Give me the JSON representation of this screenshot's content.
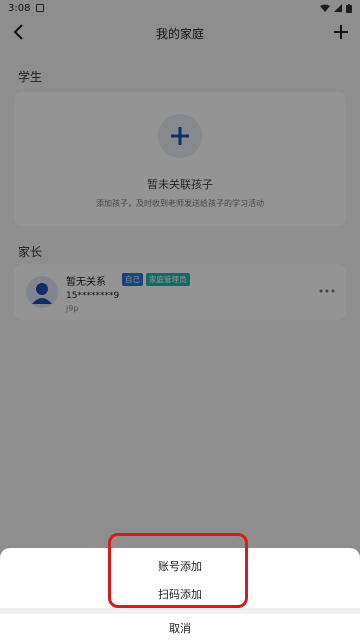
{
  "status_bar": {
    "time": "3:08"
  },
  "header": {
    "title": "我的家庭"
  },
  "students": {
    "section_label": "学生",
    "empty_title": "暂未关联孩子",
    "empty_subtitle": "添加孩子，及时收到老师发送给孩子的学习活动"
  },
  "parents": {
    "section_label": "家长",
    "items": [
      {
        "name": "暂无关系",
        "badge_self": "自己",
        "badge_admin": "家庭管理员",
        "phone": "15********9",
        "note": "j9p"
      }
    ]
  },
  "sheet": {
    "options": [
      "账号添加",
      "扫码添加"
    ],
    "cancel": "取消"
  },
  "colors": {
    "accent": "#2f6fe6",
    "admin_badge": "#1fb8a9",
    "highlight": "#d51b1b"
  }
}
